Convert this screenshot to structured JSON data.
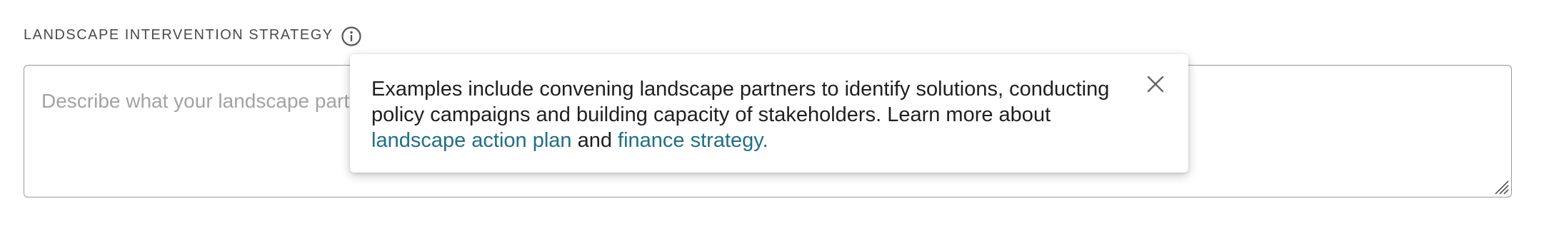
{
  "field": {
    "label": "LANDSCAPE INTERVENTION STRATEGY",
    "placeholder": "Describe what your landscape partnership intends to do to achieve its goals",
    "value": ""
  },
  "tooltip": {
    "text_before": "Examples include convening landscape partners to identify solutions, conducting policy campaigns and building capacity of stakeholders. Learn more about ",
    "link1": "landscape action plan",
    "text_between": " and ",
    "link2": "finance strategy.",
    "close_label": "Close"
  },
  "icons": {
    "info": "info-icon",
    "close": "close-icon",
    "resize": "resize-handle-icon"
  },
  "colors": {
    "label": "#4a4a4a",
    "placeholder": "#a3a3a3",
    "link": "#1f6f86",
    "border": "#9a9a9a"
  }
}
